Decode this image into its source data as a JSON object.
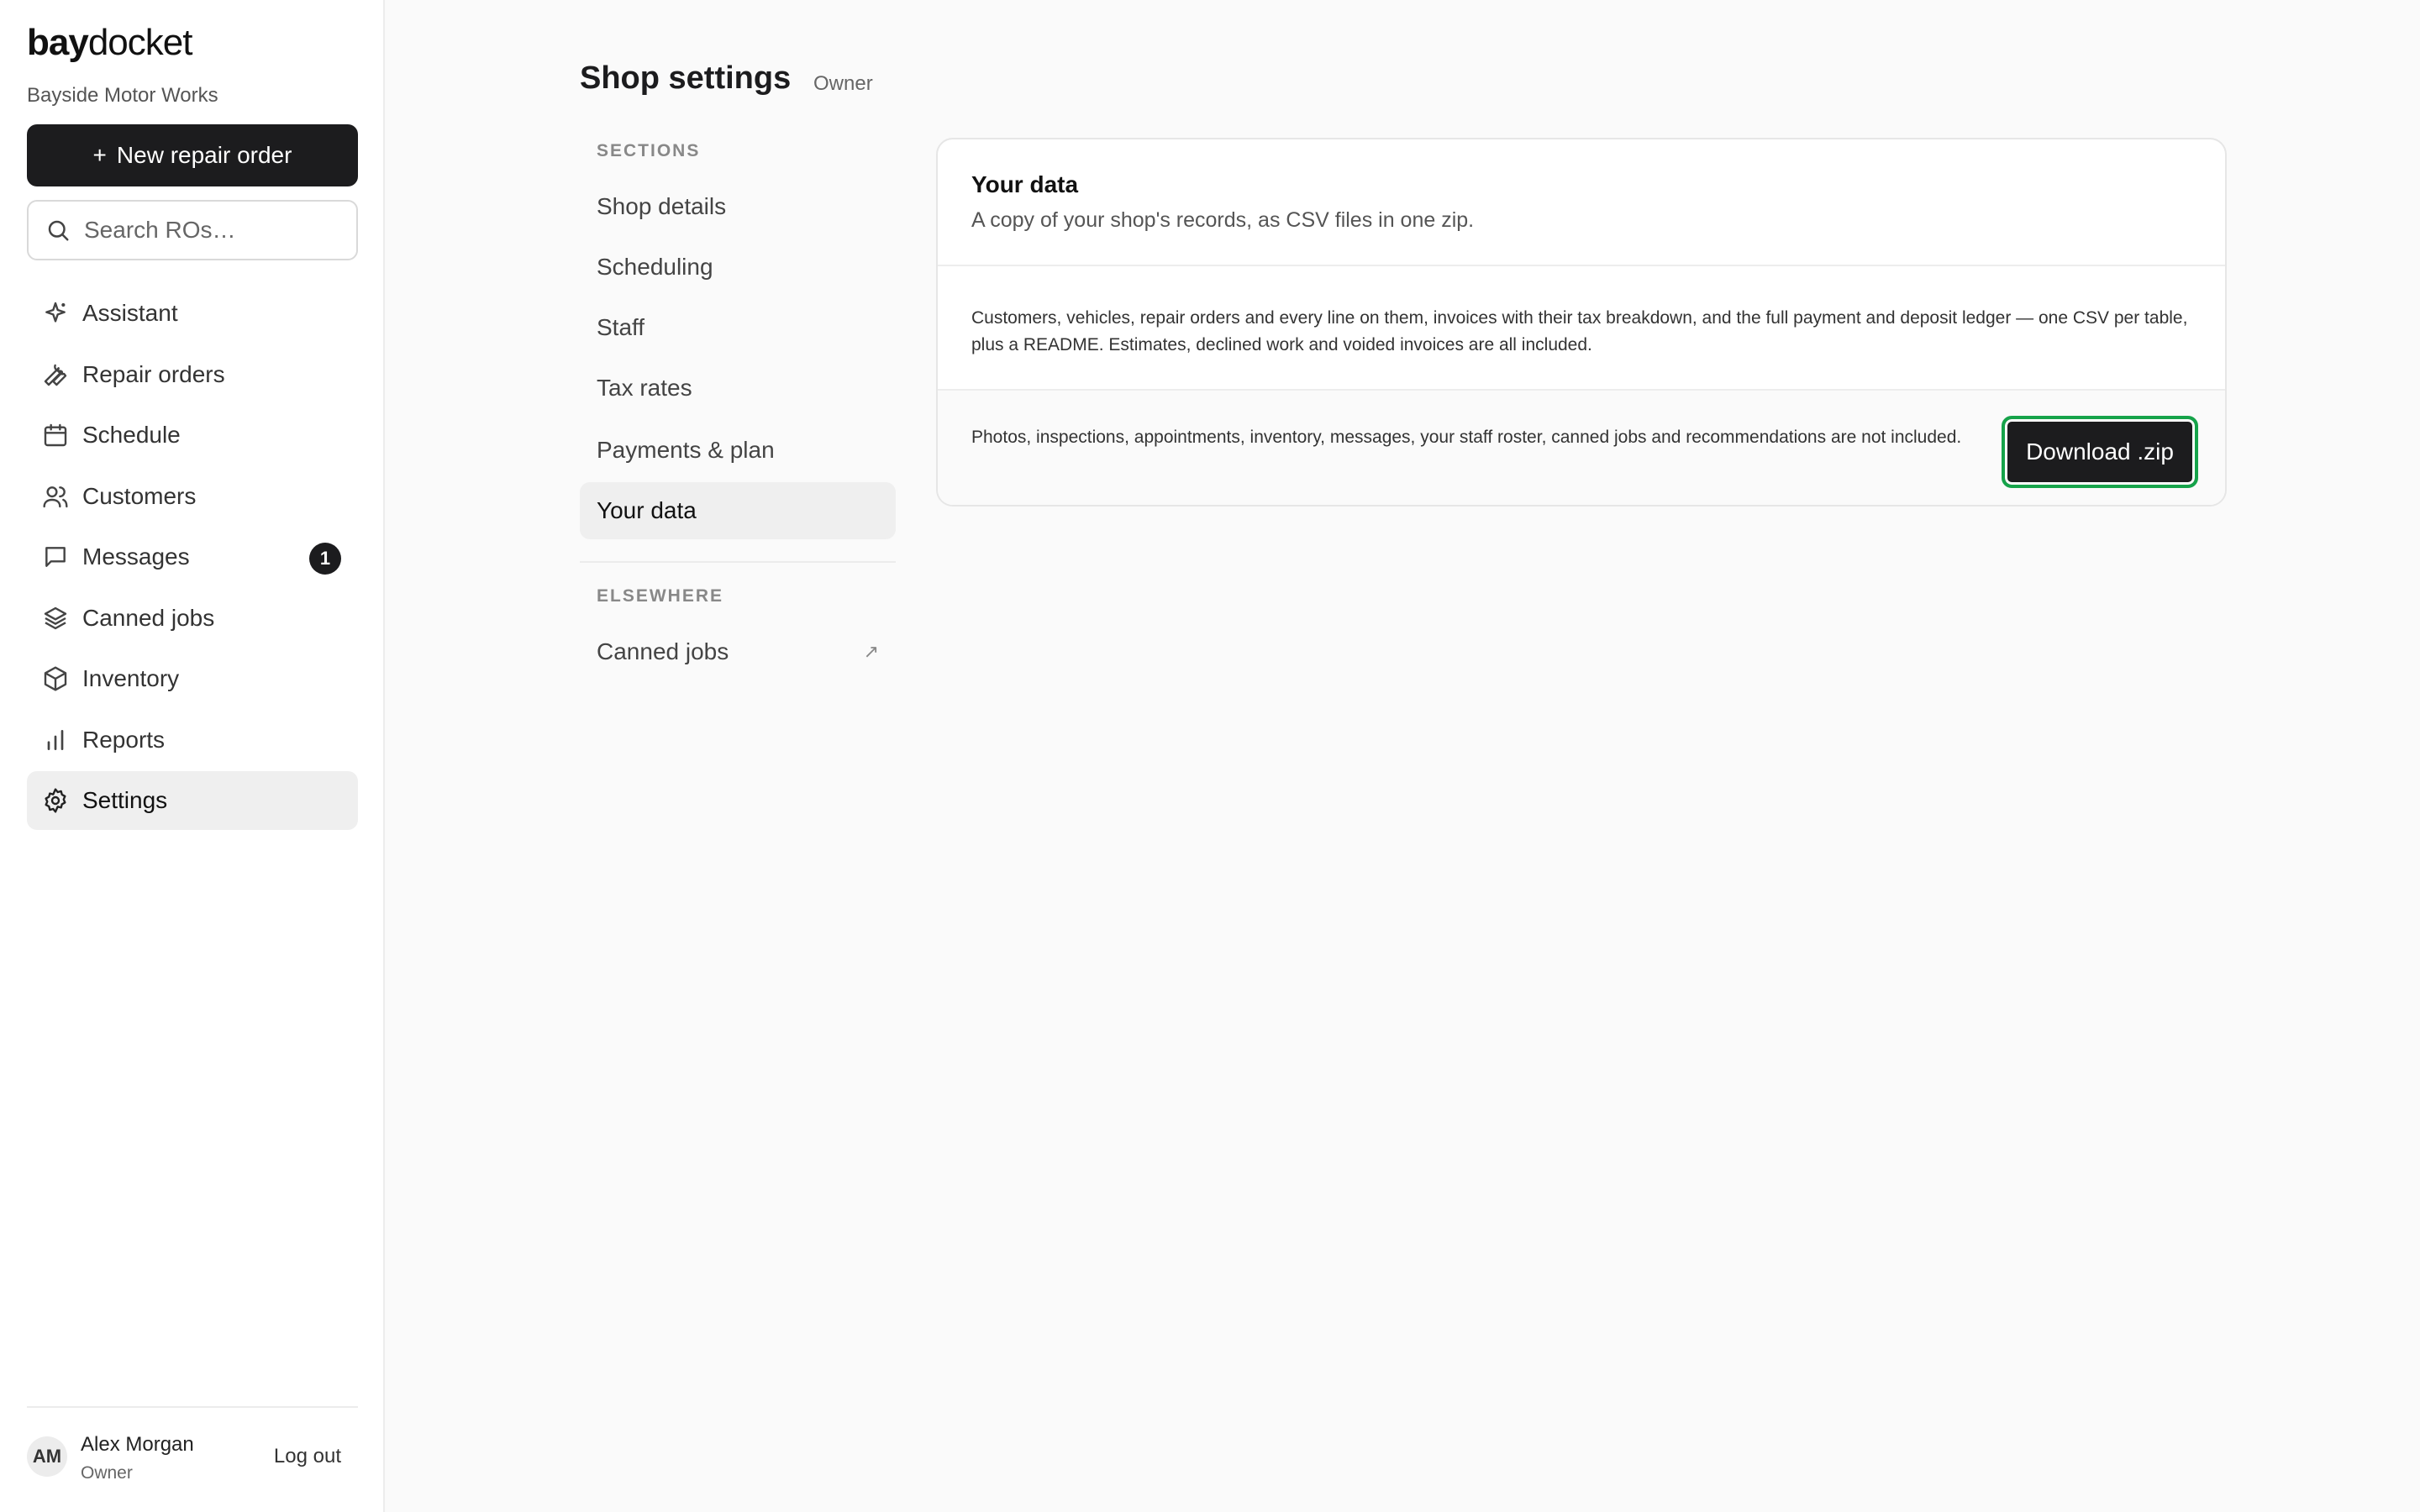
{
  "brand": {
    "bold": "bay",
    "light": "docket"
  },
  "sidebar": {
    "shop_name": "Bayside Motor Works",
    "new_button": "New repair order",
    "search_placeholder": "Search ROs…",
    "items": [
      {
        "label": "Assistant",
        "icon": "sparkle-icon"
      },
      {
        "label": "Repair orders",
        "icon": "wrench-icon"
      },
      {
        "label": "Schedule",
        "icon": "calendar-icon"
      },
      {
        "label": "Customers",
        "icon": "users-icon"
      },
      {
        "label": "Messages",
        "icon": "message-icon",
        "badge": "1"
      },
      {
        "label": "Canned jobs",
        "icon": "layers-icon"
      },
      {
        "label": "Inventory",
        "icon": "box-icon"
      },
      {
        "label": "Reports",
        "icon": "bar-chart-icon"
      },
      {
        "label": "Settings",
        "icon": "gear-icon",
        "active": true
      }
    ],
    "user": {
      "initials": "AM",
      "name": "Alex Morgan",
      "role": "Owner",
      "logout": "Log out"
    }
  },
  "page": {
    "title": "Shop settings",
    "role_tag": "Owner"
  },
  "sections": {
    "heading": "SECTIONS",
    "items": [
      {
        "label": "Shop details"
      },
      {
        "label": "Scheduling"
      },
      {
        "label": "Staff"
      },
      {
        "label": "Tax rates"
      },
      {
        "label": "Payments & plan"
      },
      {
        "label": "Your data",
        "active": true
      }
    ],
    "elsewhere_heading": "ELSEWHERE",
    "elsewhere_items": [
      {
        "label": "Canned jobs",
        "external_icon": "external-arrow-icon"
      }
    ]
  },
  "card": {
    "title": "Your data",
    "subtitle": "A copy of your shop's records, as CSV files in one zip.",
    "included": "Customers, vehicles, repair orders and every line on them, invoices with their tax breakdown, and the full payment and deposit ledger — one CSV per table, plus a README. Estimates, declined work and voided invoices are all included.",
    "excluded": "Photos, inspections, appointments, inventory, messages, your staff roster, canned jobs and recommendations are not included.",
    "download_label": "Download .zip"
  },
  "colors": {
    "primary": "#1c1c1e",
    "focus_ring": "#16a34a",
    "background": "#fafafa"
  }
}
